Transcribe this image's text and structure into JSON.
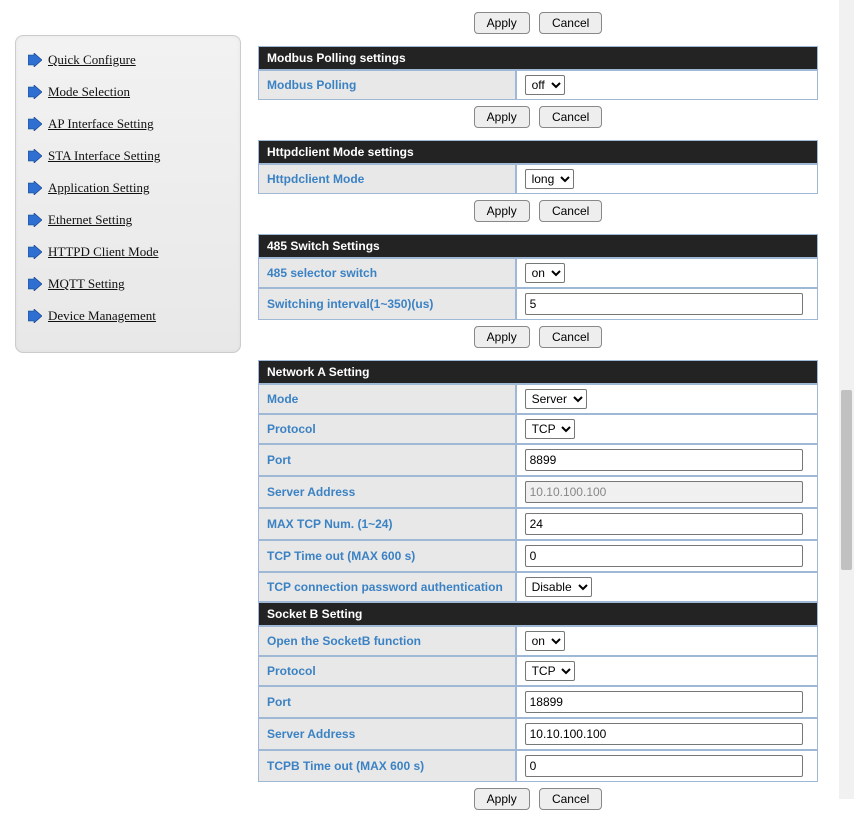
{
  "sidebar": {
    "items": [
      {
        "label": "Quick Configure"
      },
      {
        "label": "Mode Selection"
      },
      {
        "label": "AP Interface Setting"
      },
      {
        "label": "STA Interface Setting"
      },
      {
        "label": "Application Setting"
      },
      {
        "label": "Ethernet Setting"
      },
      {
        "label": "HTTPD Client Mode"
      },
      {
        "label": "MQTT Setting"
      },
      {
        "label": "Device Management"
      }
    ]
  },
  "buttons": {
    "apply": "Apply",
    "cancel": "Cancel"
  },
  "modbus": {
    "header": "Modbus Polling settings",
    "polling_label": "Modbus Polling",
    "polling_value": "off"
  },
  "httpd": {
    "header": "Httpdclient Mode settings",
    "mode_label": "Httpdclient Mode",
    "mode_value": "long"
  },
  "rs485": {
    "header": "485 Switch Settings",
    "selector_label": "485 selector switch",
    "selector_value": "on",
    "interval_label": "Switching interval(1~350)(us)",
    "interval_value": "5"
  },
  "netA": {
    "header": "Network A Setting",
    "mode_label": "Mode",
    "mode_value": "Server",
    "protocol_label": "Protocol",
    "protocol_value": "TCP",
    "port_label": "Port",
    "port_value": "8899",
    "server_label": "Server Address",
    "server_value": "10.10.100.100",
    "maxtcp_label": "MAX TCP Num. (1~24)",
    "maxtcp_value": "24",
    "timeout_label": "TCP Time out (MAX 600 s)",
    "timeout_value": "0",
    "auth_label": "TCP connection password authentication",
    "auth_value": "Disable"
  },
  "socketB": {
    "header": "Socket B Setting",
    "open_label": "Open the SocketB function",
    "open_value": "on",
    "protocol_label": "Protocol",
    "protocol_value": "TCP",
    "port_label": "Port",
    "port_value": "18899",
    "server_label": "Server Address",
    "server_value": "10.10.100.100",
    "timeout_label": "TCPB Time out (MAX 600 s)",
    "timeout_value": "0"
  }
}
